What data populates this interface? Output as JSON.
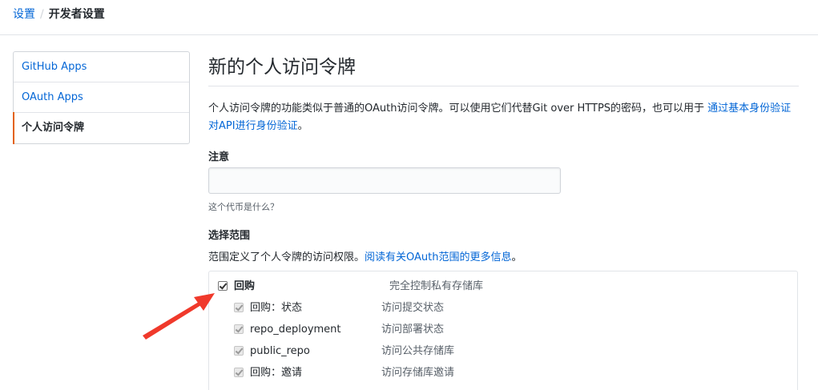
{
  "breadcrumb": {
    "root": "设置",
    "separator": "/",
    "current": "开发者设置"
  },
  "sidebar": {
    "items": [
      {
        "label": "GitHub Apps",
        "selected": false
      },
      {
        "label": "OAuth Apps",
        "selected": false
      },
      {
        "label": "个人访问令牌",
        "selected": true
      }
    ]
  },
  "main": {
    "title": "新的个人访问令牌",
    "description": "个人访问令牌的功能类似于普通的OAuth访问令牌。可以使用它们代替Git over HTTPS的密码，也可以用于 ",
    "description_link": "通过基本身份验证对API进行身份验证",
    "description_end": "。",
    "note": {
      "label": "注意",
      "value": "",
      "help": "这个代币是什么？"
    },
    "scopes": {
      "label": "选择范围",
      "description": "范围定义了个人令牌的访问权限。",
      "description_link": "阅读有关OAuth范围的更多信息",
      "description_end": "。",
      "items": [
        {
          "name": "回购",
          "meaning": "完全控制私有存储库",
          "checked": true
        },
        {
          "name": "回购：状态",
          "meaning": "访问提交状态",
          "checked": true
        },
        {
          "name": "repo_deployment",
          "meaning": "访问部署状态",
          "checked": true
        },
        {
          "name": "public_repo",
          "meaning": "访问公共存储库",
          "checked": true
        },
        {
          "name": "回购：邀请",
          "meaning": "访问存储库邀请",
          "checked": true
        }
      ]
    }
  },
  "colors": {
    "link": "#0366d6",
    "selected_accent": "#e36209",
    "annotation_arrow": "#f0392b"
  }
}
